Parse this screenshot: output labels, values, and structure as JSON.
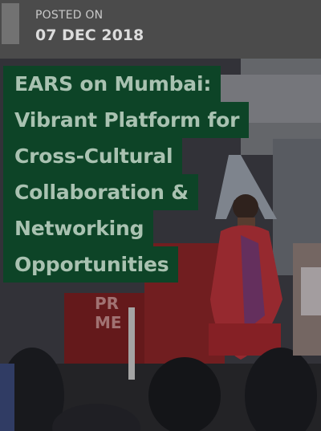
{
  "post": {
    "posted_label": "POSTED ON",
    "date": "07 DEC 2018"
  },
  "title": {
    "lines": [
      "EARS on Mumbai:",
      "Vibrant Platform for",
      "Cross-Cultural",
      "Collaboration &",
      "Networking",
      "Opportunities"
    ]
  },
  "colors": {
    "title_bg": "#0d4427",
    "title_text": "#a9c2b1",
    "header_bg": "#4b4b4b",
    "accent": "#727272"
  }
}
